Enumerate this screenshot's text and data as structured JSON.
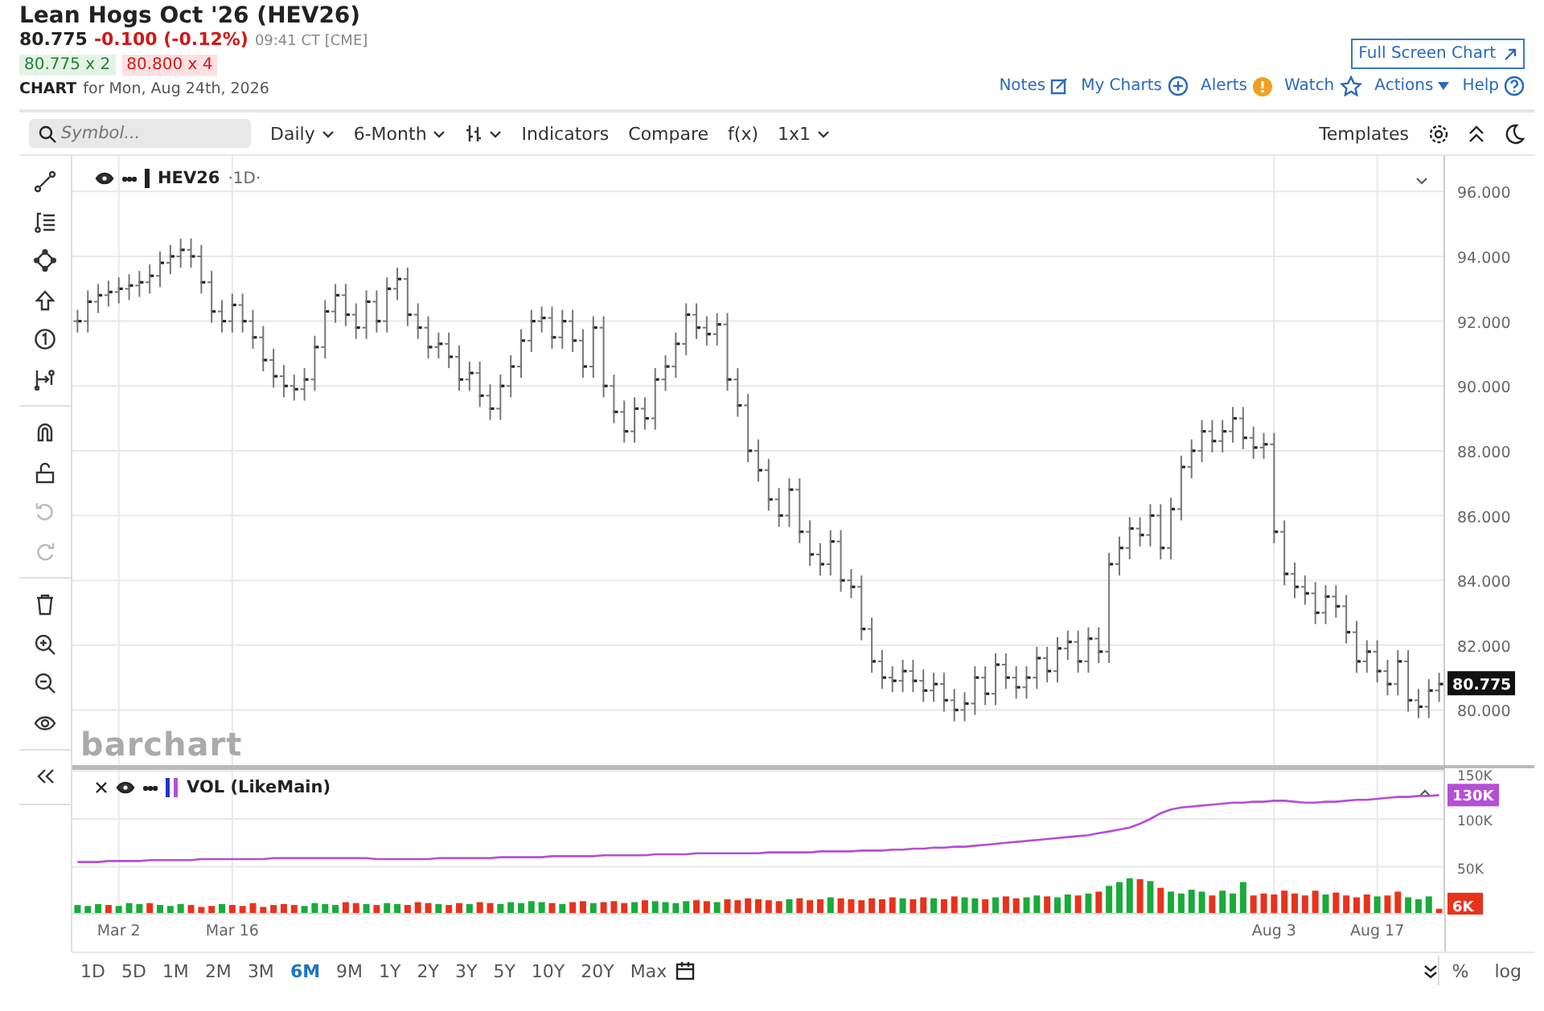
{
  "header": {
    "title": "Lean Hogs Oct '26 (HEV26)",
    "last": "80.775",
    "change": "-0.100 (-0.12%)",
    "time": "09:41 CT [CME]",
    "bid": "80.775 x 2",
    "ask": "80.800 x 4",
    "chart_label": "CHART",
    "chart_date": "for Mon, Aug 24th, 2026"
  },
  "full_screen_button": {
    "label": "Full Screen Chart"
  },
  "links": [
    {
      "label": "Notes",
      "kind": "note"
    },
    {
      "label": "My Charts",
      "kind": "add"
    },
    {
      "label": "Alerts",
      "kind": "alert"
    },
    {
      "label": "Watch",
      "kind": "star"
    },
    {
      "label": "Actions",
      "kind": "caret"
    },
    {
      "label": "Help",
      "kind": "help"
    }
  ],
  "toolbar": {
    "search": {
      "placeholder": "Symbol..."
    },
    "items": [
      {
        "label": "Daily",
        "kind": "dropdown"
      },
      {
        "label": "6-Month",
        "kind": "dropdown"
      },
      {
        "kind": "bar-type"
      },
      {
        "label": "Indicators",
        "kind": "plain"
      },
      {
        "label": "Compare",
        "kind": "plain"
      },
      {
        "label": "f(x)",
        "kind": "plain"
      },
      {
        "label": "1x1",
        "kind": "dropdown"
      }
    ],
    "right": [
      {
        "label": "Templates",
        "kind": "plain"
      },
      {
        "kind": "gear"
      },
      {
        "kind": "collapse"
      },
      {
        "kind": "moon"
      }
    ]
  },
  "tools": [
    [
      {
        "kind": "line",
        "disabled": false
      },
      {
        "kind": "fib",
        "disabled": false
      },
      {
        "kind": "shape",
        "disabled": false
      },
      {
        "kind": "arrow",
        "disabled": false
      },
      {
        "kind": "number",
        "disabled": false
      },
      {
        "kind": "measure",
        "disabled": false
      }
    ],
    [
      {
        "kind": "magnet",
        "disabled": false
      },
      {
        "kind": "lock",
        "disabled": false
      },
      {
        "kind": "undo",
        "disabled": true
      },
      {
        "kind": "redo",
        "disabled": true
      }
    ],
    [
      {
        "kind": "trash",
        "disabled": false
      },
      {
        "kind": "zoom-in",
        "disabled": false
      },
      {
        "kind": "zoom-out",
        "disabled": false
      },
      {
        "kind": "eye",
        "disabled": false
      }
    ],
    [
      {
        "kind": "collapse-left",
        "disabled": false
      }
    ]
  ],
  "price_pane": {
    "symbol": "HEV26",
    "interval": "·1D·",
    "logo": "barchart",
    "last_price": "80.775",
    "chart_data": {
      "type": "scatter",
      "grid": true,
      "ylim": [
        78.2,
        97.1
      ],
      "yticks": [
        {
          "value": 80,
          "label": "80.000"
        },
        {
          "value": 82,
          "label": "82.000"
        },
        {
          "value": 84,
          "label": "84.000"
        },
        {
          "value": 86,
          "label": "86.000"
        },
        {
          "value": 88,
          "label": "88.000"
        },
        {
          "value": 90,
          "label": "90.000"
        },
        {
          "value": 92,
          "label": "92.000"
        },
        {
          "value": 94,
          "label": "94.000"
        },
        {
          "value": 96,
          "label": "96.000"
        }
      ],
      "series": [
        {
          "color": "#222222",
          "values": [
            92.0,
            92.6,
            92.8,
            92.9,
            93.0,
            93.1,
            93.2,
            93.4,
            93.8,
            94.0,
            94.2,
            94.0,
            93.2,
            92.3,
            92.0,
            92.5,
            92.0,
            91.5,
            90.8,
            90.3,
            90.0,
            89.9,
            90.2,
            91.2,
            92.3,
            92.8,
            92.2,
            91.8,
            92.6,
            92.0,
            93.0,
            93.3,
            92.2,
            91.8,
            91.2,
            91.3,
            90.9,
            90.2,
            90.4,
            89.7,
            89.3,
            90.0,
            90.6,
            91.4,
            92.0,
            92.1,
            91.5,
            92.0,
            91.4,
            90.6,
            91.8,
            90.0,
            89.2,
            88.6,
            89.3,
            89.0,
            90.2,
            90.6,
            91.3,
            92.2,
            91.8,
            91.6,
            91.9,
            90.2,
            89.4,
            88.0,
            87.4,
            86.5,
            86.0,
            86.8,
            85.5,
            84.8,
            84.5,
            85.2,
            84.0,
            83.8,
            82.5,
            81.5,
            81.0,
            80.9,
            81.2,
            80.9,
            80.6,
            80.8,
            80.3,
            80.0,
            80.2,
            81.0,
            80.5,
            81.4,
            81.0,
            80.7,
            81.0,
            81.6,
            81.2,
            81.9,
            82.1,
            81.5,
            82.2,
            81.8,
            84.5,
            85.0,
            85.6,
            85.4,
            86.0,
            85.0,
            86.2,
            87.5,
            88.0,
            88.6,
            88.3,
            88.6,
            89.0,
            88.4,
            88.1,
            88.2,
            85.5,
            84.2,
            83.8,
            83.6,
            83.0,
            83.5,
            83.2,
            82.4,
            81.5,
            81.8,
            81.2,
            80.8,
            81.5,
            80.3,
            80.1,
            80.6,
            80.8
          ]
        }
      ]
    }
  },
  "volume_pane": {
    "legend": "VOL (LikeMain)",
    "oi_label": "130K",
    "volume_label": "6K",
    "date_labels": [
      {
        "label": "Mar 2"
      },
      {
        "label": "Mar 16"
      },
      {
        "label": "Aug 3"
      },
      {
        "label": "Aug 17"
      }
    ],
    "chart_data": {
      "type": "bar",
      "grid": true,
      "ylim": [
        0,
        153
      ],
      "yticks": [
        {
          "value": 50,
          "label": "50K"
        },
        {
          "value": 100,
          "label": "100K"
        },
        {
          "value": 150,
          "label": "150K"
        }
      ],
      "series": [
        {
          "color": "#1aab3b",
          "values": [
            10,
            9,
            11,
            null,
            9,
            12,
            11,
            null,
            10,
            9,
            11,
            null,
            null,
            null,
            11,
            null,
            null,
            null,
            null,
            null,
            null,
            null,
            9,
            12,
            11,
            10,
            null,
            null,
            11,
            null,
            12,
            11,
            null,
            null,
            null,
            11,
            null,
            null,
            11,
            null,
            null,
            11,
            13,
            12,
            14,
            13,
            null,
            11,
            null,
            null,
            12,
            null,
            null,
            null,
            13,
            null,
            14,
            13,
            12,
            14,
            null,
            null,
            13,
            null,
            null,
            null,
            null,
            null,
            null,
            16,
            null,
            null,
            null,
            18,
            null,
            null,
            null,
            null,
            null,
            null,
            17,
            null,
            null,
            17,
            null,
            null,
            18,
            17,
            null,
            18,
            null,
            null,
            18,
            20,
            null,
            18,
            21,
            null,
            22,
            null,
            30,
            34,
            38,
            null,
            35,
            null,
            24,
            22,
            26,
            24,
            null,
            25,
            22,
            34,
            null,
            null,
            null,
            null,
            null,
            null,
            null,
            21,
            null,
            null,
            null,
            null,
            19,
            null,
            null,
            18,
            16,
            19,
            null
          ]
        },
        {
          "color": "#e8331c",
          "values": [
            null,
            null,
            null,
            10,
            null,
            null,
            null,
            12,
            null,
            null,
            null,
            10,
            8,
            9,
            null,
            10,
            9,
            12,
            8,
            10,
            11,
            10,
            null,
            null,
            null,
            null,
            13,
            12,
            null,
            10,
            null,
            null,
            10,
            13,
            12,
            null,
            10,
            12,
            null,
            13,
            12,
            null,
            null,
            null,
            null,
            null,
            12,
            null,
            13,
            14,
            null,
            13,
            14,
            12,
            null,
            15,
            null,
            null,
            null,
            null,
            15,
            14,
            null,
            16,
            15,
            17,
            16,
            15,
            14,
            null,
            17,
            15,
            16,
            null,
            17,
            16,
            15,
            17,
            16,
            18,
            null,
            16,
            18,
            null,
            16,
            19,
            null,
            null,
            16,
            null,
            19,
            17,
            null,
            null,
            19,
            null,
            null,
            20,
            null,
            24,
            null,
            null,
            null,
            37,
            null,
            28,
            null,
            null,
            null,
            null,
            20,
            null,
            null,
            null,
            20,
            22,
            21,
            25,
            22,
            20,
            25,
            null,
            23,
            20,
            18,
            21,
            null,
            20,
            24,
            null,
            null,
            null,
            6
          ]
        }
      ]
    },
    "open_interest": {
      "chart_data": {
        "type": "line",
        "ylim": [
          0,
          153
        ],
        "series": [
          {
            "color": "#b44fd6",
            "values": [
              55,
              55,
              55,
              56,
              56,
              56,
              56,
              57,
              57,
              57,
              57,
              57,
              58,
              58,
              58,
              58,
              58,
              58,
              58,
              59,
              59,
              59,
              59,
              59,
              59,
              59,
              59,
              59,
              59,
              58,
              58,
              58,
              58,
              58,
              58,
              59,
              59,
              59,
              59,
              59,
              59,
              60,
              60,
              60,
              60,
              60,
              61,
              61,
              61,
              61,
              61,
              62,
              62,
              62,
              62,
              62,
              63,
              63,
              63,
              63,
              64,
              64,
              64,
              64,
              64,
              64,
              64,
              65,
              65,
              65,
              65,
              65,
              66,
              66,
              66,
              66,
              67,
              67,
              67,
              68,
              68,
              69,
              69,
              70,
              70,
              71,
              71,
              72,
              73,
              74,
              75,
              76,
              77,
              78,
              79,
              80,
              81,
              82,
              83,
              85,
              87,
              89,
              91,
              95,
              100,
              106,
              110,
              112,
              113,
              114,
              115,
              116,
              117,
              117,
              118,
              118,
              119,
              119,
              118,
              117,
              117,
              118,
              118,
              119,
              120,
              120,
              121,
              122,
              123,
              123,
              124,
              124,
              125
            ]
          }
        ]
      }
    }
  },
  "ranges": [
    {
      "label": "1D",
      "selected": false
    },
    {
      "label": "5D",
      "selected": false
    },
    {
      "label": "1M",
      "selected": false
    },
    {
      "label": "2M",
      "selected": false
    },
    {
      "label": "3M",
      "selected": false
    },
    {
      "label": "6M",
      "selected": true
    },
    {
      "label": "9M",
      "selected": false
    },
    {
      "label": "1Y",
      "selected": false
    },
    {
      "label": "2Y",
      "selected": false
    },
    {
      "label": "3Y",
      "selected": false
    },
    {
      "label": "5Y",
      "selected": false
    },
    {
      "label": "10Y",
      "selected": false
    },
    {
      "label": "20Y",
      "selected": false
    },
    {
      "label": "Max",
      "selected": false
    }
  ],
  "scale_buttons": [
    {
      "label": "%"
    },
    {
      "label": "log"
    }
  ]
}
